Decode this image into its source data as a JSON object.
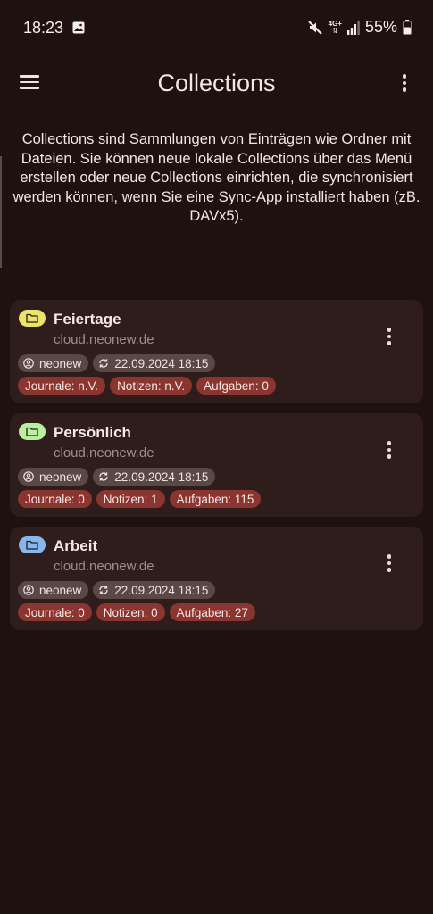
{
  "status_bar": {
    "time": "18:23",
    "network": "4G+",
    "battery": "55%"
  },
  "header": {
    "title": "Collections"
  },
  "intro_text": "Collections sind Sammlungen von Einträgen wie Ordner mit Dateien. Sie können neue lokale Collections über das Menü erstellen oder neue Collections einrichten, die synchronisiert werden können, wenn Sie eine Sync-App installiert haben (zB. DAVx5).",
  "collections": [
    {
      "name": "Feiertage",
      "host": "cloud.neonew.de",
      "owner": "neonew",
      "sync": "22.09.2024 18:15",
      "journals": "Journale: n.V.",
      "notes": "Notizen: n.V.",
      "tasks": "Aufgaben: 0",
      "color": "#ece46a"
    },
    {
      "name": "Persönlich",
      "host": "cloud.neonew.de",
      "owner": "neonew",
      "sync": "22.09.2024 18:15",
      "journals": "Journale: 0",
      "notes": "Notizen: 1",
      "tasks": "Aufgaben: 115",
      "color": "#b9f09f"
    },
    {
      "name": "Arbeit",
      "host": "cloud.neonew.de",
      "owner": "neonew",
      "sync": "22.09.2024 18:15",
      "journals": "Journale: 0",
      "notes": "Notizen: 0",
      "tasks": "Aufgaben: 27",
      "color": "#86b8ef"
    }
  ]
}
